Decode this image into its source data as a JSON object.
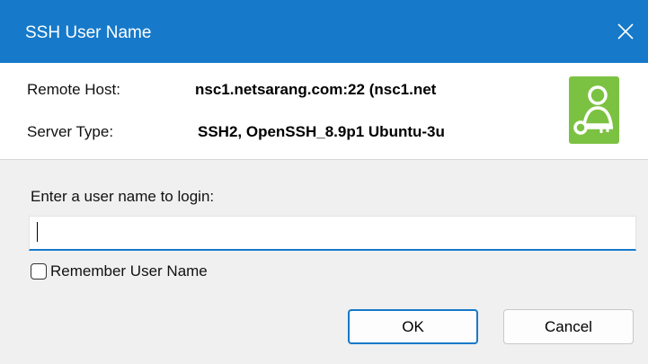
{
  "window": {
    "title": "SSH User Name",
    "close_icon": "close-icon"
  },
  "info": {
    "remote_host_label": "Remote Host:",
    "remote_host_value": "nsc1.netsarang.com:22 (nsc1.net",
    "server_type_label": "Server Type:",
    "server_type_value": "SSH2, OpenSSH_8.9p1 Ubuntu-3u",
    "icon": "user-key-icon",
    "icon_color": "#7cc242"
  },
  "form": {
    "prompt": "Enter a user name to login:",
    "username_value": "",
    "remember_label": "Remember User Name",
    "remember_checked": false
  },
  "buttons": {
    "ok_label": "OK",
    "cancel_label": "Cancel"
  },
  "colors": {
    "accent": "#1679c9",
    "background": "#f0f0f0"
  }
}
